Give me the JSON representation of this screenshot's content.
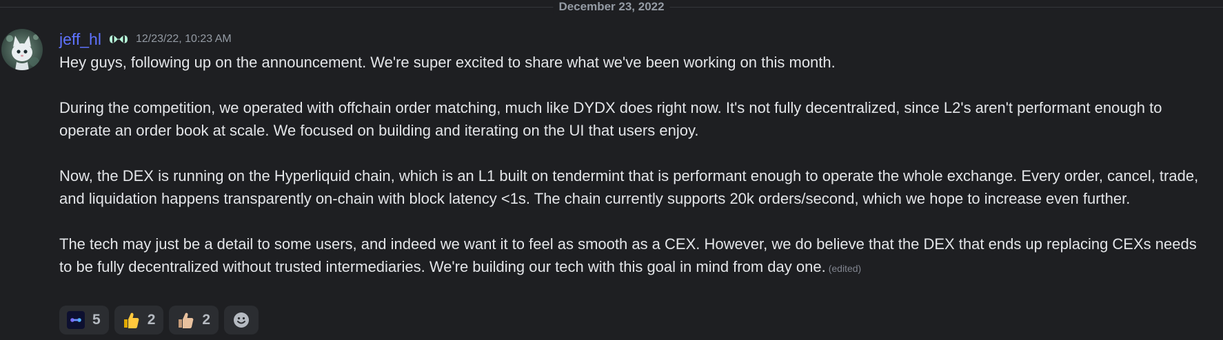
{
  "divider": {
    "date": "December 23, 2022"
  },
  "message": {
    "author": "jeff_hl",
    "author_color": "#5f73ff",
    "timestamp": "12/23/22, 10:23 AM",
    "paragraphs": [
      "Hey guys, following up on the announcement. We're super excited to share what we've been working on this month.",
      "During the competition, we operated with offchain order matching, much like DYDX does right now. It's not fully decentralized, since L2's aren't performant enough to operate an order book at scale. We focused on building and iterating on the UI that users enjoy.",
      "Now, the DEX is running on the Hyperliquid chain, which is an L1 built on tendermint that is performant enough to operate the whole exchange. Every order, cancel, trade, and liquidation happens transparently on-chain with block latency <1s. The chain currently supports 20k orders/second, which we hope to increase even further.",
      "The tech may just be a detail to some users, and indeed we want it to feel as smooth as a CEX. However, we do believe that the DEX that ends up replacing CEXs needs to be fully decentralized without trusted intermediaries. We're building our tech with this goal in mind from day one."
    ],
    "edited_label": "(edited)"
  },
  "reactions": [
    {
      "emoji": "hyperliquid-emoji",
      "count": "5"
    },
    {
      "emoji": "thumbs-up-emoji",
      "count": "2"
    },
    {
      "emoji": "thumbs-up-light-emoji",
      "count": "2"
    }
  ],
  "add_reaction": {
    "icon": "smiley-add-reaction-icon"
  },
  "colors": {
    "background": "#1e1f22",
    "text": "#e3e5e8",
    "muted": "#949ba4",
    "reaction_bg": "#2b2d31"
  }
}
